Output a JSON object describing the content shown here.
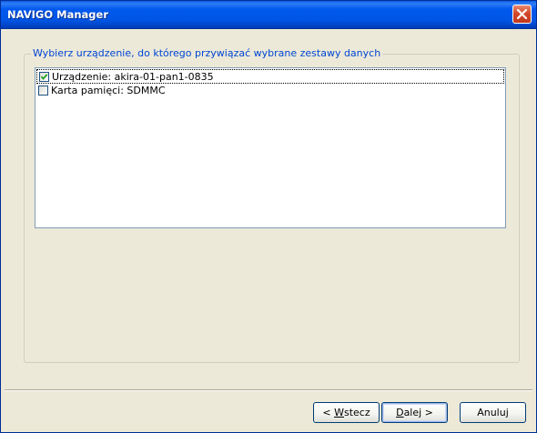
{
  "window": {
    "title": "NAVIGO Manager"
  },
  "group": {
    "label": "Wybierz urządzenie, do którego przywiązać wybrane zestawy danych"
  },
  "devices": [
    {
      "label": "Urządzenie: akira-01-pan1-0835",
      "checked": true
    },
    {
      "label": "Karta pamięci: SDMMC",
      "checked": false
    }
  ],
  "buttons": {
    "back_prefix": "< ",
    "back_mnemonic": "W",
    "back_rest": "stecz",
    "next_mnemonic": "D",
    "next_rest": "alej >",
    "cancel": "Anuluj"
  },
  "colors": {
    "titlebar": "#0055e5",
    "close": "#d2482a",
    "group_label": "#0046d5"
  }
}
